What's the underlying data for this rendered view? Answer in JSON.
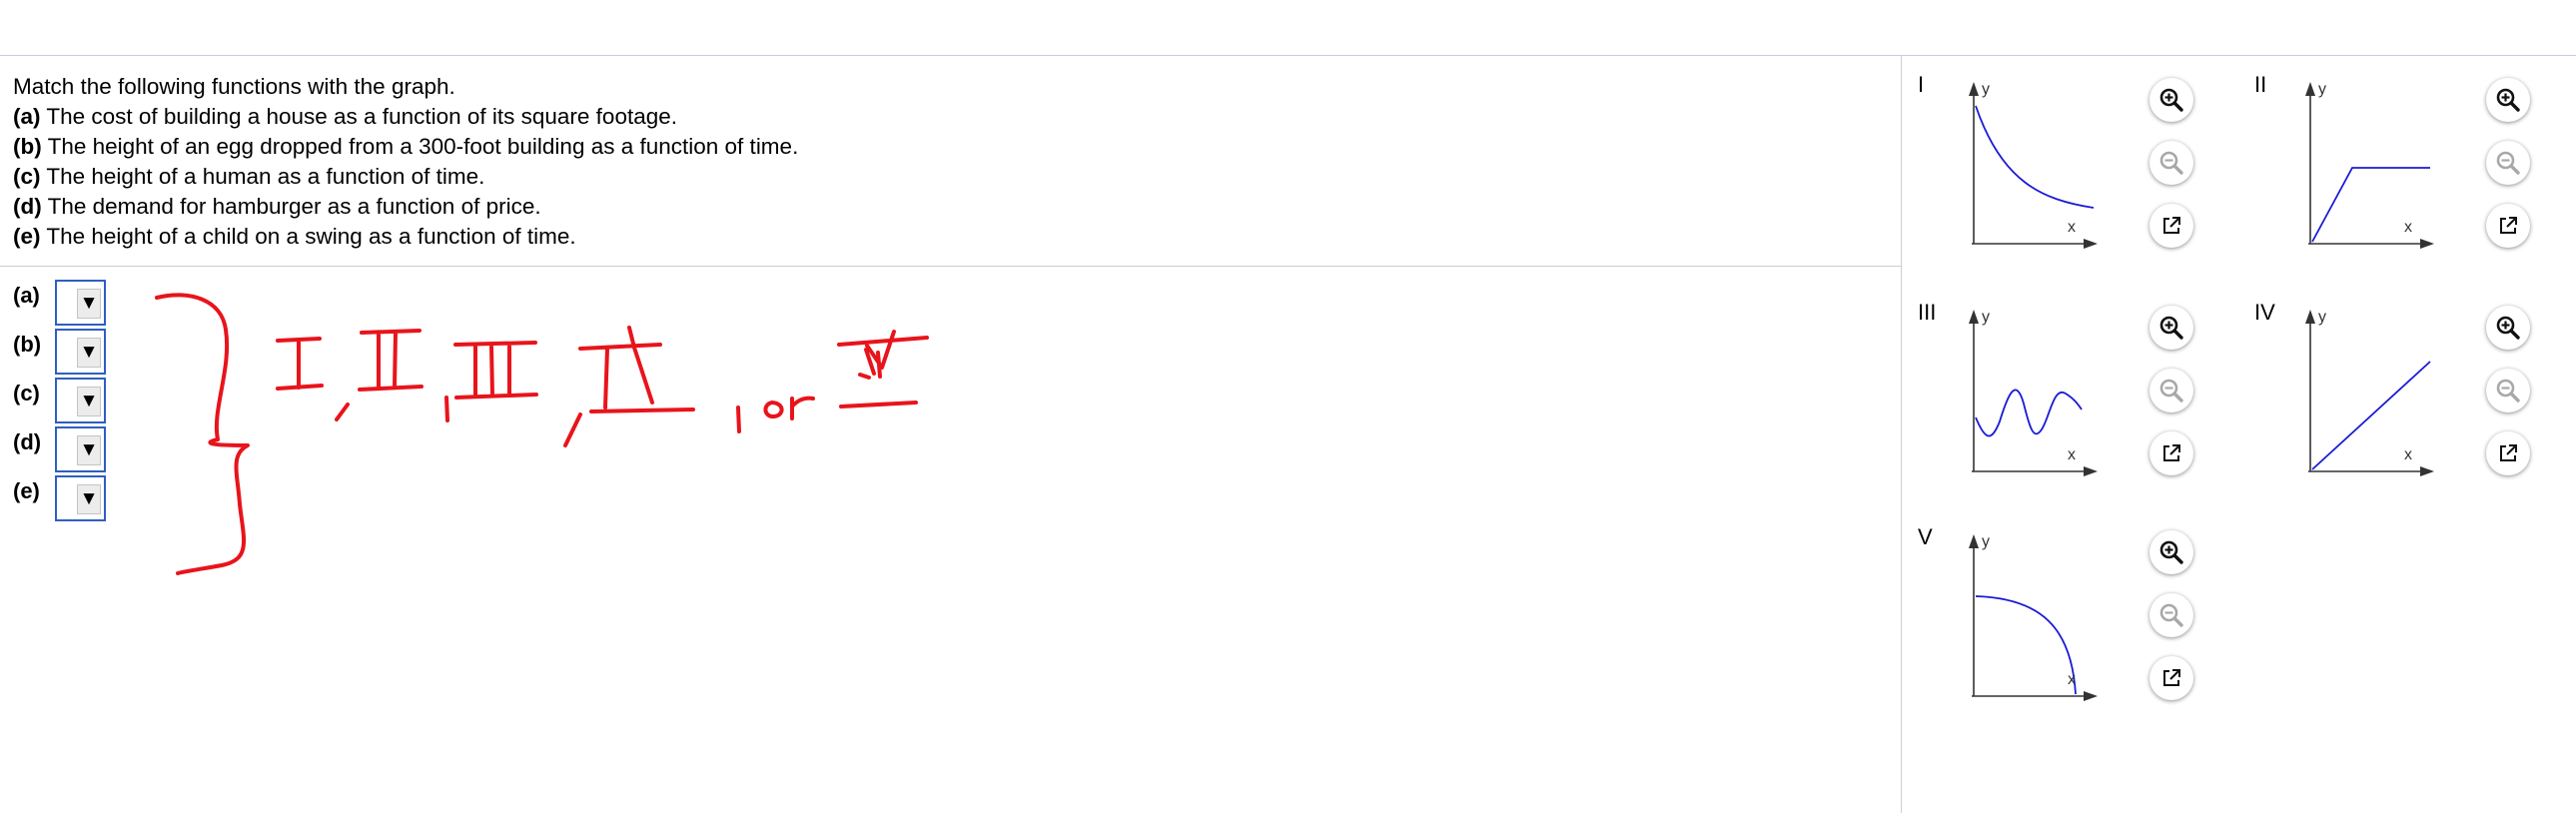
{
  "question": {
    "prompt": "Match the following functions with the graph.",
    "items": [
      {
        "label": "(a)",
        "text": " The cost of building a house as a function of its square footage."
      },
      {
        "label": "(b)",
        "text": " The height of an egg dropped from a 300-foot building as a function of time."
      },
      {
        "label": "(c)",
        "text": " The height of a human as a function of time."
      },
      {
        "label": "(d)",
        "text": " The demand for hamburger as a function of price."
      },
      {
        "label": "(e)",
        "text": " The height of a child on a swing as a function of time."
      }
    ]
  },
  "answers": [
    {
      "label": "(a)",
      "value": ""
    },
    {
      "label": "(b)",
      "value": ""
    },
    {
      "label": "(c)",
      "value": ""
    },
    {
      "label": "(d)",
      "value": ""
    },
    {
      "label": "(e)",
      "value": ""
    }
  ],
  "dropdown_glyph": "▼",
  "graphs": [
    {
      "roman": "I",
      "xlabel": "x",
      "ylabel": "y",
      "shape": "decreasing-convex"
    },
    {
      "roman": "II",
      "xlabel": "x",
      "ylabel": "y",
      "shape": "increase-then-flat"
    },
    {
      "roman": "III",
      "xlabel": "x",
      "ylabel": "y",
      "shape": "oscillating"
    },
    {
      "roman": "IV",
      "xlabel": "x",
      "ylabel": "y",
      "shape": "linear-increasing"
    },
    {
      "roman": "V",
      "xlabel": "x",
      "ylabel": "y",
      "shape": "decreasing-concave"
    }
  ],
  "graph_buttons": [
    "zoom-in-icon",
    "zoom-out-icon",
    "popout-icon"
  ],
  "colors": {
    "curve": "#1a1ad6",
    "ink": "#e8141b",
    "dropdown_border": "#2f5fbf",
    "axis": "#333333"
  }
}
